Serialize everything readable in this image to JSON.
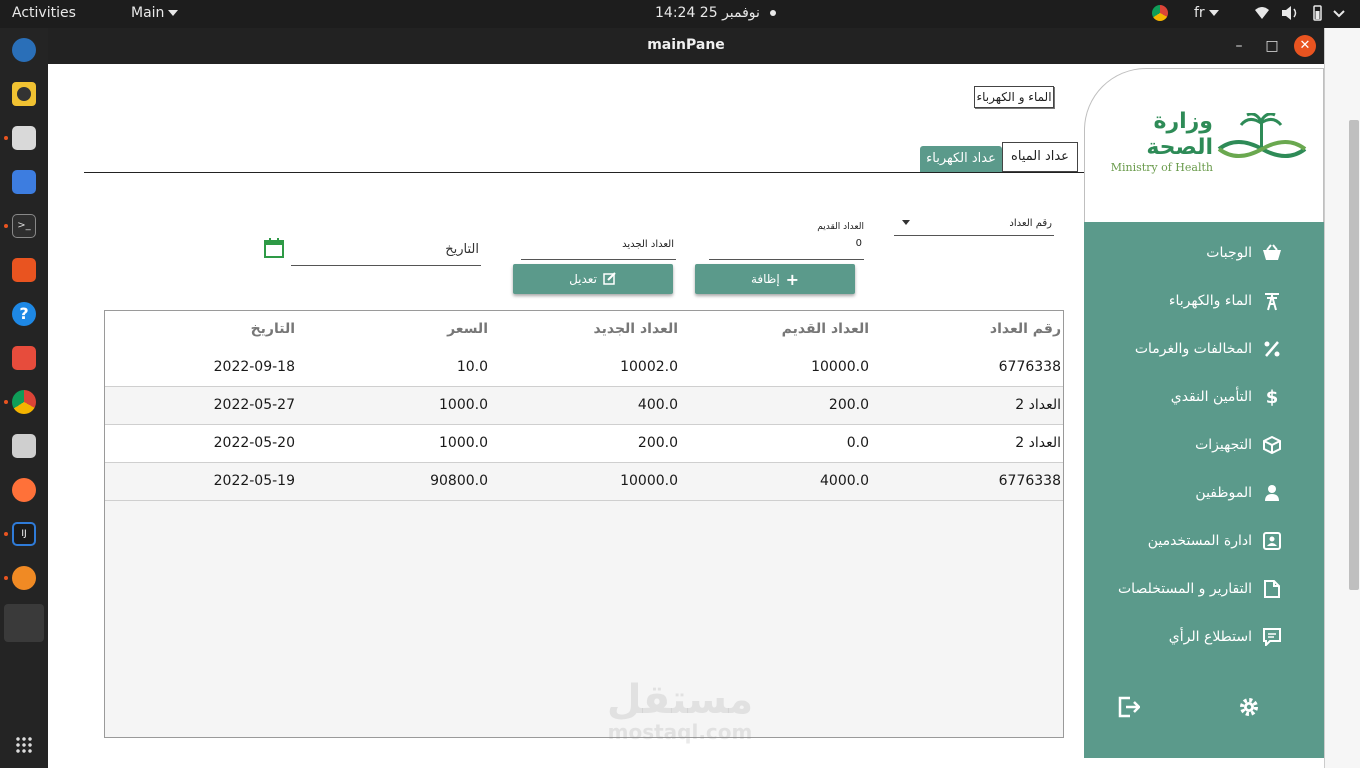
{
  "topbar": {
    "activities": "Activities",
    "app_menu": "Main",
    "clock": "14:24  25 نوفمبر",
    "language": "fr"
  },
  "window": {
    "title": "mainPane"
  },
  "header": {
    "section_label": "الماء و الكهرباء"
  },
  "tabs": [
    {
      "label": "عداد الكهرباء",
      "active": true
    },
    {
      "label": "عداد المياه",
      "active": false
    }
  ],
  "logo": {
    "arabic": "وزارة الصحة",
    "english": "Ministry of Health"
  },
  "sidebar": {
    "items": [
      {
        "label": "الوجبات",
        "icon": "basket-icon"
      },
      {
        "label": "الماء والكهرباء",
        "icon": "tower-icon"
      },
      {
        "label": "المخالفات والغرمات",
        "icon": "percent-icon"
      },
      {
        "label": "التأمين النقدي",
        "icon": "dollar-icon"
      },
      {
        "label": "التجهيزات",
        "icon": "box-icon"
      },
      {
        "label": "الموظفين",
        "icon": "user-icon"
      },
      {
        "label": "ادارة المستخدمين",
        "icon": "id-card-icon"
      },
      {
        "label": "التقارير و المستخلصات",
        "icon": "file-icon"
      },
      {
        "label": "استطلاع الرأي",
        "icon": "comment-icon"
      }
    ]
  },
  "form": {
    "meter_number_placeholder": "رقم العداد",
    "old_meter_label": "العداد القديم",
    "old_meter_value": "0",
    "new_meter_placeholder": "العداد الجديد",
    "date_placeholder": "التاريخ"
  },
  "buttons": {
    "add": "إظافة",
    "edit": "تعديل"
  },
  "table": {
    "headers": [
      "رقم العداد",
      "العداد القديم",
      "العداد الجديد",
      "السعر",
      "التاريخ"
    ],
    "rows": [
      [
        "6776338",
        "10000.0",
        "10002.0",
        "10.0",
        "2022-09-18"
      ],
      [
        "العداد 2",
        "200.0",
        "400.0",
        "1000.0",
        "2022-05-27"
      ],
      [
        "العداد 2",
        "0.0",
        "200.0",
        "1000.0",
        "2022-05-20"
      ],
      [
        "6776338",
        "4000.0",
        "10000.0",
        "90800.0",
        "2022-05-19"
      ]
    ]
  },
  "watermark": {
    "arabic": "مستقل",
    "latin": "mostaql.com"
  },
  "colors": {
    "accent": "#5b9a8b",
    "ubuntu_orange": "#e95420"
  }
}
